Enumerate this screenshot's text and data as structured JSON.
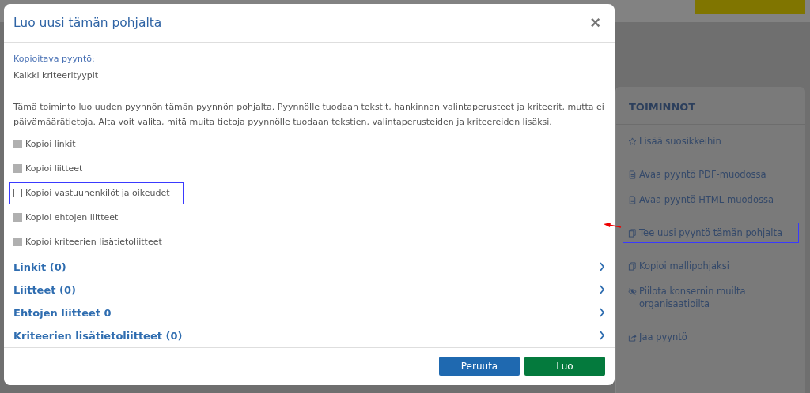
{
  "dialog": {
    "title": "Luo uusi tämän pohjalta",
    "close": "×",
    "source_label": "Kopioitava pyyntö:",
    "source_value": "Kaikki kriteerityypit",
    "description": "Tämä toiminto luo uuden pyynnön tämän pyynnön pohjalta. Pyynnölle tuodaan tekstit, hankinnan valintaperusteet ja kriteerit, mutta ei päivämäärätietoja. Alta voit valita, mitä muita tietoja pyynnölle tuodaan tekstien, valintaperusteiden ja kriteereiden lisäksi.",
    "options": [
      {
        "label": "Kopioi linkit",
        "checked": false,
        "disabled": true,
        "highlighted": false
      },
      {
        "label": "Kopioi liitteet",
        "checked": false,
        "disabled": true,
        "highlighted": false
      },
      {
        "label": "Kopioi vastuuhenkilöt ja oikeudet",
        "checked": false,
        "disabled": false,
        "highlighted": true
      },
      {
        "label": "Kopioi ehtojen liitteet",
        "checked": false,
        "disabled": true,
        "highlighted": false
      },
      {
        "label": "Kopioi kriteerien lisätietoliitteet",
        "checked": false,
        "disabled": true,
        "highlighted": false
      }
    ],
    "sections": [
      {
        "label": "Linkit (0)",
        "expanded": false
      },
      {
        "label": "Liitteet (0)",
        "expanded": false
      },
      {
        "label": "Ehtojen liitteet 0",
        "expanded": false
      },
      {
        "label": "Kriteerien lisätietoliitteet (0)",
        "expanded": false
      }
    ],
    "buttons": [
      {
        "label": "Peruuta",
        "kind": "secondary"
      },
      {
        "label": "Luo",
        "kind": "primary"
      }
    ]
  },
  "actions": {
    "title": "TOIMINNOT",
    "groups": [
      [
        {
          "label": "Lisää suosikkeihin",
          "kind": "star",
          "highlighted": false
        }
      ],
      [
        {
          "label": "Avaa pyyntö PDF-muodossa",
          "kind": "file",
          "highlighted": false
        },
        {
          "label": "Avaa pyyntö HTML-muodossa",
          "kind": "file",
          "highlighted": false
        }
      ],
      [
        {
          "label": "Tee uusi pyyntö tämän pohjalta",
          "kind": "copy",
          "highlighted": true
        }
      ],
      [
        {
          "label": "Kopioi mallipohjaksi",
          "kind": "copy",
          "highlighted": false
        },
        {
          "label": "Piilota konsernin muilta organisaatioilta",
          "kind": "eye-slash",
          "highlighted": false
        }
      ],
      [
        {
          "label": "Jaa pyyntö",
          "kind": "share",
          "highlighted": false
        }
      ]
    ]
  }
}
